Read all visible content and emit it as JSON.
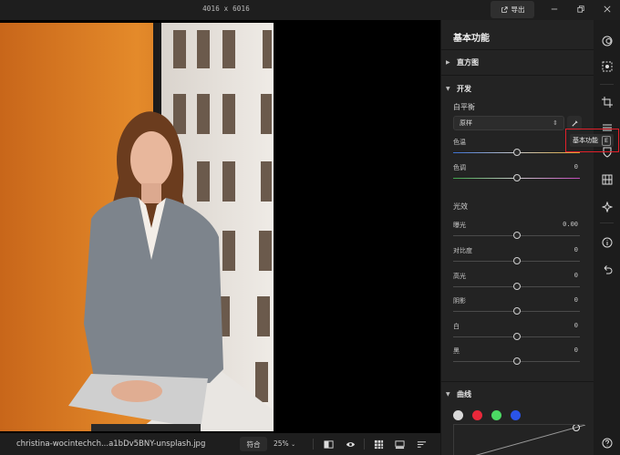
{
  "titlebar": {
    "image_size": "4016 x 6016",
    "export_label": "导出"
  },
  "status": {
    "filename": "christina-wocintechch...a1bDv5BNY-unsplash.jpg",
    "fit_label": "符合",
    "zoom": "25%"
  },
  "panel": {
    "title": "基本功能",
    "histogram_label": "直方图",
    "develop_label": "开发",
    "white_balance_label": "白平衡",
    "wb_preset": "原样",
    "temp_label": "色温",
    "tint_label": "色调",
    "tint_value": "0",
    "light_label": "光效",
    "sliders": [
      {
        "label": "曝光",
        "value": "0.00"
      },
      {
        "label": "对比度",
        "value": "0"
      },
      {
        "label": "高光",
        "value": "0"
      },
      {
        "label": "阴影",
        "value": "0"
      },
      {
        "label": "白",
        "value": "0"
      },
      {
        "label": "黑",
        "value": "0"
      }
    ],
    "curves_label": "曲线"
  },
  "tooltip": {
    "label": "基本功能",
    "shortcut": "E"
  },
  "colors": {
    "accent_red": "#e0202a",
    "dot_red": "#e8283a",
    "dot_green": "#4cd964",
    "dot_blue": "#2a54e8"
  }
}
